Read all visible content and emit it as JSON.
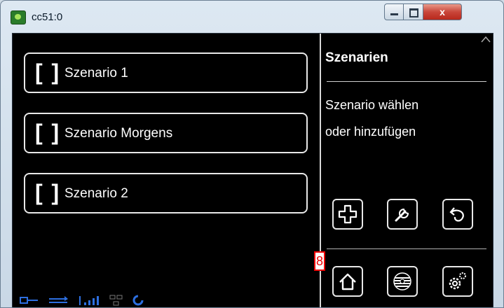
{
  "window": {
    "title": "cc51:0",
    "close_label": "x"
  },
  "scenarios": [
    {
      "brackets": "[ ]",
      "label": "Szenario 1"
    },
    {
      "brackets": "[ ]",
      "label": "Szenario Morgens"
    },
    {
      "brackets": "[ ]",
      "label": "Szenario 2"
    }
  ],
  "panel": {
    "title": "Szenarien",
    "line1": "Szenario wählen",
    "line2": "oder hinzufügen"
  },
  "badge": {
    "number": "8"
  },
  "status_icons": [
    "network-icon",
    "transfer-icon",
    "signal-icon",
    "lan-icon",
    "refresh-icon"
  ],
  "action_icons": [
    "add-icon",
    "wrench-icon",
    "back-icon"
  ],
  "nav_icons": [
    "home-icon",
    "fan-icon",
    "gears-icon"
  ]
}
